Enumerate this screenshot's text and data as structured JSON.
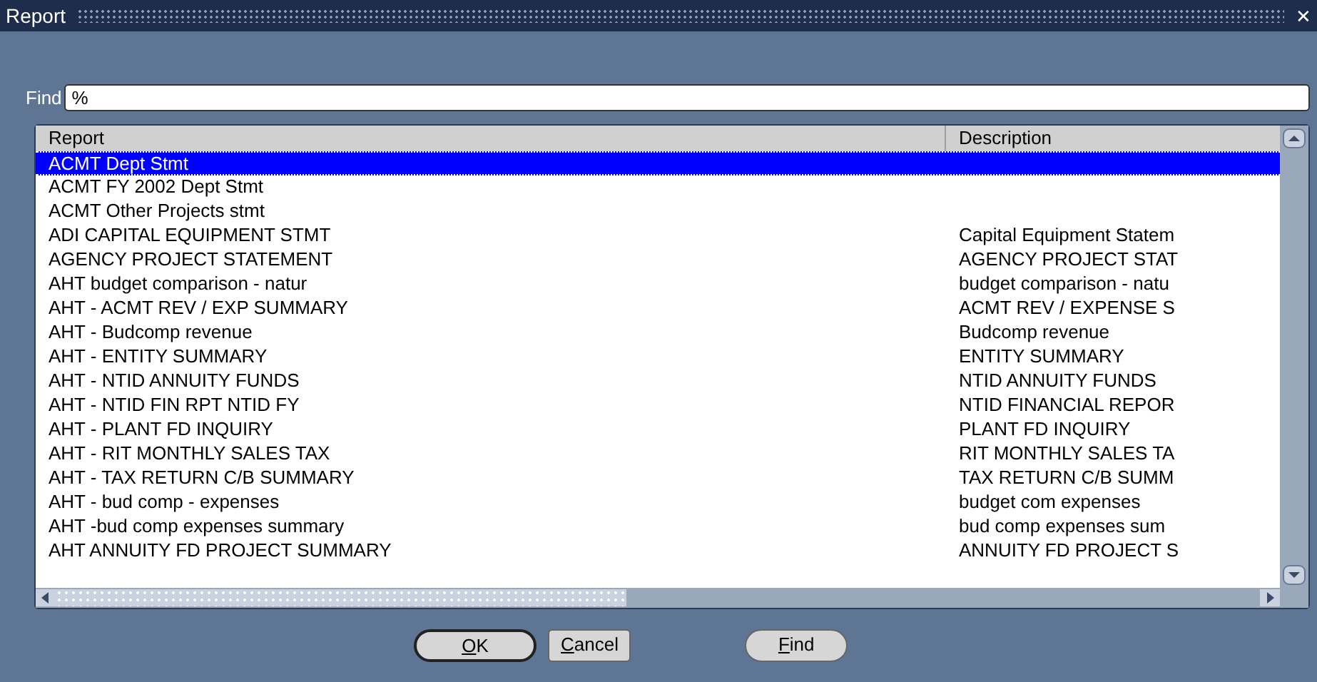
{
  "window": {
    "title": "Report",
    "close": "✕"
  },
  "find": {
    "label": "Find",
    "value": "%"
  },
  "table": {
    "columns": [
      "Report",
      "Description"
    ],
    "rows": [
      {
        "report": "ACMT Dept Stmt",
        "description": "",
        "selected": true
      },
      {
        "report": "ACMT FY 2002 Dept Stmt",
        "description": "",
        "selected": false
      },
      {
        "report": "ACMT Other Projects stmt",
        "description": "",
        "selected": false
      },
      {
        "report": "ADI CAPITAL EQUIPMENT STMT",
        "description": "Capital Equipment Statem",
        "selected": false
      },
      {
        "report": "AGENCY PROJECT STATEMENT",
        "description": "AGENCY PROJECT STAT",
        "selected": false
      },
      {
        "report": "AHT  budget comparison - natur",
        "description": "budget comparison - natu",
        "selected": false
      },
      {
        "report": "AHT - ACMT REV / EXP SUMMARY",
        "description": "ACMT REV / EXPENSE S",
        "selected": false
      },
      {
        "report": "AHT - Budcomp revenue",
        "description": "Budcomp revenue",
        "selected": false
      },
      {
        "report": "AHT - ENTITY SUMMARY",
        "description": "ENTITY SUMMARY",
        "selected": false
      },
      {
        "report": "AHT - NTID ANNUITY FUNDS",
        "description": "NTID ANNUITY FUNDS",
        "selected": false
      },
      {
        "report": "AHT - NTID FIN RPT NTID FY",
        "description": "NTID FINANCIAL REPOR",
        "selected": false
      },
      {
        "report": "AHT - PLANT FD INQUIRY",
        "description": "PLANT FD INQUIRY",
        "selected": false
      },
      {
        "report": "AHT - RIT MONTHLY SALES TAX",
        "description": "RIT MONTHLY SALES TA",
        "selected": false
      },
      {
        "report": "AHT - TAX RETURN C/B SUMMARY",
        "description": "TAX RETURN C/B SUMM",
        "selected": false
      },
      {
        "report": "AHT - bud comp - expenses",
        "description": "budget com expenses",
        "selected": false
      },
      {
        "report": "AHT -bud comp expenses summary",
        "description": "bud comp expenses sum",
        "selected": false
      },
      {
        "report": "AHT ANNUITY FD PROJECT SUMMARY",
        "description": "ANNUITY FD PROJECT S",
        "selected": false
      }
    ]
  },
  "buttons": [
    {
      "label": "OK",
      "kind": "pill",
      "underline_first": true
    },
    {
      "label": "Cancel",
      "kind": "square",
      "underline_first": true
    },
    {
      "label": "Find",
      "kind": "pill",
      "underline_first": true
    }
  ]
}
